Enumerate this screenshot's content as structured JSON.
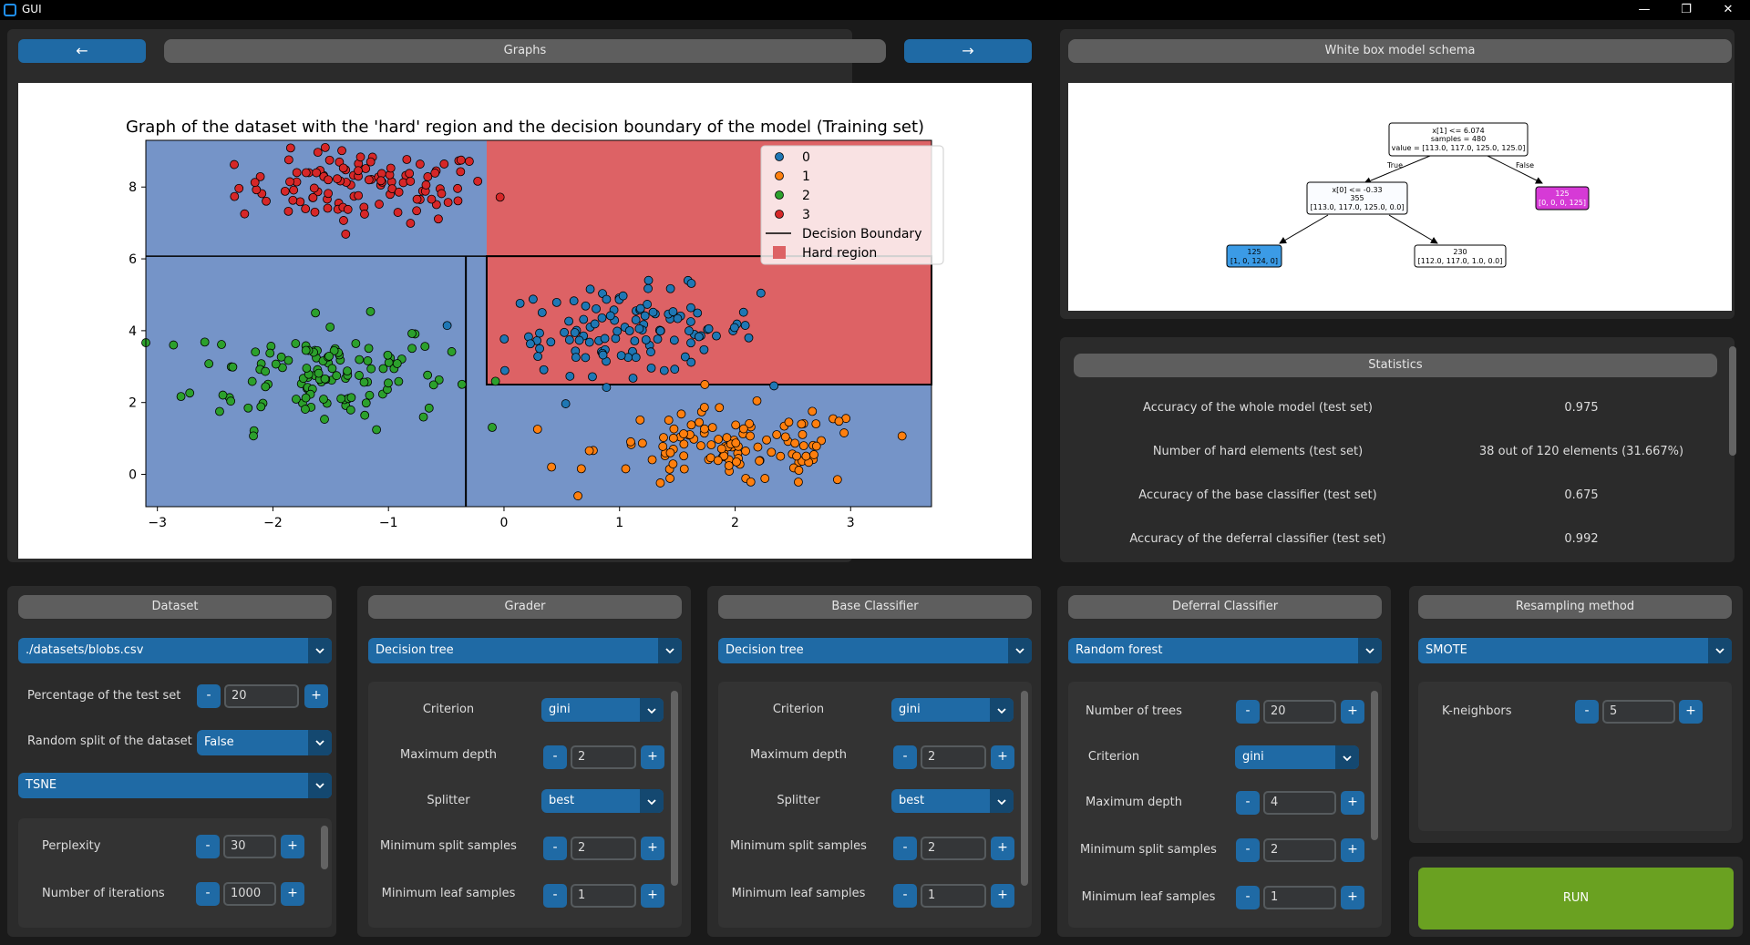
{
  "window": {
    "title": "GUI",
    "minimize": "—",
    "restore": "❐",
    "close": "✕"
  },
  "graphs": {
    "prev_label": "←",
    "header": "Graphs",
    "next_label": "→"
  },
  "schema": {
    "header": "White box model schema",
    "root": {
      "line1": "x[1] <= 6.074",
      "line2": "samples = 480",
      "line3": "value = [113.0, 117.0, 125.0, 125.0]"
    },
    "true_label": "True",
    "false_label": "False",
    "mid": {
      "line1": "x[0] <= -0.33",
      "line2": "355",
      "line3": "[113.0, 117.0, 125.0, 0.0]"
    },
    "right_leaf": {
      "line1": "125",
      "line2": "[0, 0, 0, 125]"
    },
    "left_leaf": {
      "line1": "125",
      "line2": "[1, 0, 124, 0]"
    },
    "mid_leaf": {
      "line1": "230",
      "line2": "[112.0, 117.0, 1.0, 0.0]"
    },
    "colors": {
      "right_leaf": "#d63ad6",
      "left_leaf": "#3b9be6",
      "white": "#ffffff"
    }
  },
  "statistics": {
    "header": "Statistics",
    "rows": [
      {
        "label": "Accuracy of the whole model (test set)",
        "value": "0.975"
      },
      {
        "label": "Number of hard elements (test set)",
        "value": "38 out of 120 elements (31.667%)"
      },
      {
        "label": "Accuracy of the base classifier (test set)",
        "value": "0.675"
      },
      {
        "label": "Accuracy of the deferral classifier (test set)",
        "value": "0.992"
      }
    ]
  },
  "dataset": {
    "header": "Dataset",
    "file": "./datasets/blobs.csv",
    "test_pct_label": "Percentage of the test set",
    "test_pct_value": "20",
    "random_split_label": "Random split of the dataset",
    "random_split_value": "False",
    "reduction": "TSNE",
    "perplexity_label": "Perplexity",
    "perplexity_value": "30",
    "iterations_label": "Number of iterations",
    "iterations_value": "1000"
  },
  "grader": {
    "header": "Grader",
    "model": "Decision tree",
    "criterion_label": "Criterion",
    "criterion_value": "gini",
    "max_depth_label": "Maximum depth",
    "max_depth_value": "2",
    "splitter_label": "Splitter",
    "splitter_value": "best",
    "min_split_label": "Minimum split samples",
    "min_split_value": "2",
    "min_leaf_label": "Minimum leaf samples",
    "min_leaf_value": "1"
  },
  "base": {
    "header": "Base Classifier",
    "model": "Decision tree",
    "criterion_label": "Criterion",
    "criterion_value": "gini",
    "max_depth_label": "Maximum depth",
    "max_depth_value": "2",
    "splitter_label": "Splitter",
    "splitter_value": "best",
    "min_split_label": "Minimum split samples",
    "min_split_value": "2",
    "min_leaf_label": "Minimum leaf samples",
    "min_leaf_value": "1"
  },
  "deferral": {
    "header": "Deferral Classifier",
    "model": "Random forest",
    "trees_label": "Number of trees",
    "trees_value": "20",
    "criterion_label": "Criterion",
    "criterion_value": "gini",
    "max_depth_label": "Maximum depth",
    "max_depth_value": "4",
    "min_split_label": "Minimum split samples",
    "min_split_value": "2",
    "min_leaf_label": "Minimum leaf samples",
    "min_leaf_value": "1"
  },
  "resampling": {
    "header": "Resampling method",
    "method": "SMOTE",
    "k_label": "K-neighbors",
    "k_value": "5"
  },
  "run_label": "RUN",
  "stepper": {
    "minus": "-",
    "plus": "+"
  },
  "chart_data": {
    "type": "scatter",
    "title": "Graph of the dataset with the 'hard' region and the decision boundary of the model (Training set)",
    "xlim": [
      -3.1,
      3.7
    ],
    "ylim": [
      -0.9,
      9.3
    ],
    "x_ticks": [
      -3,
      -2,
      -1,
      0,
      1,
      2,
      3
    ],
    "x_tick_labels": [
      "−3",
      "−2",
      "−1",
      "0",
      "1",
      "2",
      "3"
    ],
    "y_ticks": [
      0,
      2,
      4,
      6,
      8
    ],
    "y_tick_labels": [
      "0",
      "2",
      "4",
      "6",
      "8"
    ],
    "grid": false,
    "legend_position": "top-right",
    "legend": [
      "0",
      "1",
      "2",
      "3",
      "Decision Boundary",
      "Hard region"
    ],
    "colors": {
      "0": "#1f77b4",
      "1": "#ff7f0e",
      "2": "#2ca02c",
      "3": "#d62728",
      "bg_blue": "#7594c8",
      "hard": "#dd6265"
    },
    "decision_boundary": {
      "x_split": -0.33,
      "y_split": 6.074
    },
    "hard_regions": [
      {
        "x": [
          -0.15,
          3.7
        ],
        "y": [
          6.074,
          9.3
        ]
      },
      {
        "x": [
          -0.15,
          3.7
        ],
        "y": [
          2.5,
          6.074
        ]
      }
    ],
    "series": [
      {
        "name": "3",
        "cluster": {
          "cx": -1.2,
          "cy": 8.0,
          "sx": 0.55,
          "sy": 0.5,
          "n": 110
        }
      },
      {
        "name": "2",
        "cluster": {
          "cx": -1.6,
          "cy": 2.8,
          "sx": 0.55,
          "sy": 0.75,
          "n": 125
        }
      },
      {
        "name": "0",
        "cluster": {
          "cx": 1.1,
          "cy": 4.0,
          "sx": 0.55,
          "sy": 0.6,
          "n": 117
        }
      },
      {
        "name": "1",
        "cluster": {
          "cx": 2.0,
          "cy": 0.7,
          "sx": 0.6,
          "sy": 0.55,
          "n": 117
        }
      }
    ]
  }
}
